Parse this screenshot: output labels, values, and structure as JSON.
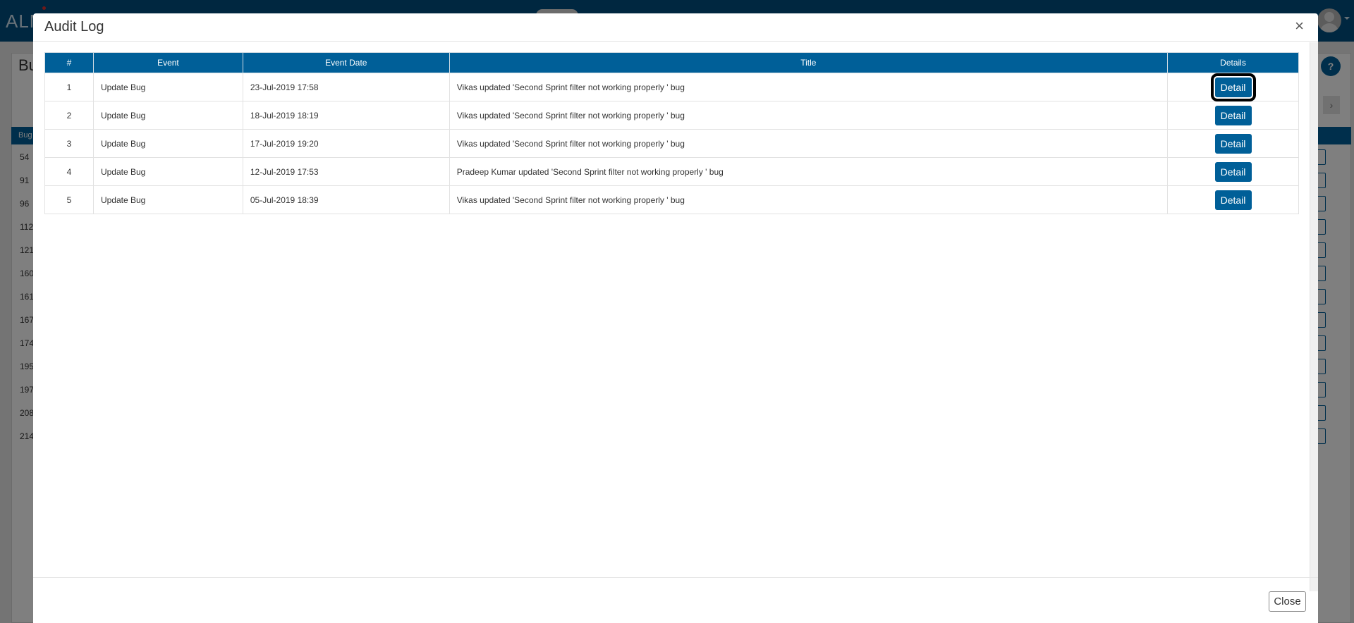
{
  "app": {
    "brand": "ALM",
    "page_heading": "Bu",
    "help_icon": "?",
    "nav_arrow": "›",
    "table_col_label": "Bug",
    "bg_ids": [
      "54",
      "91",
      "96",
      "112",
      "121",
      "160",
      "161",
      "167",
      "174",
      "195",
      "197",
      "208",
      "214"
    ]
  },
  "modal": {
    "title": "Audit Log",
    "close_x": "×",
    "close_button": "Close",
    "columns": [
      "#",
      "Event",
      "Event Date",
      "Title",
      "Details"
    ],
    "rows": [
      {
        "num": "1",
        "event": "Update Bug",
        "date": "23-Jul-2019 17:58",
        "title": "Vikas updated 'Second Sprint filter not working properly ' bug",
        "action": "Detail"
      },
      {
        "num": "2",
        "event": "Update Bug",
        "date": "18-Jul-2019 18:19",
        "title": "Vikas updated 'Second Sprint filter not working properly ' bug",
        "action": "Detail"
      },
      {
        "num": "3",
        "event": "Update Bug",
        "date": "17-Jul-2019 19:20",
        "title": "Vikas updated 'Second Sprint filter not working properly ' bug",
        "action": "Detail"
      },
      {
        "num": "4",
        "event": "Update Bug",
        "date": "12-Jul-2019 17:53",
        "title": "Pradeep Kumar updated 'Second Sprint filter not working properly ' bug",
        "action": "Detail"
      },
      {
        "num": "5",
        "event": "Update Bug",
        "date": "05-Jul-2019 18:39",
        "title": "Vikas updated 'Second Sprint filter not working properly ' bug",
        "action": "Detail"
      }
    ]
  },
  "colors": {
    "header_blue": "#005f98",
    "topbar_blue": "#004f80",
    "highlight_outline": "#000000"
  }
}
